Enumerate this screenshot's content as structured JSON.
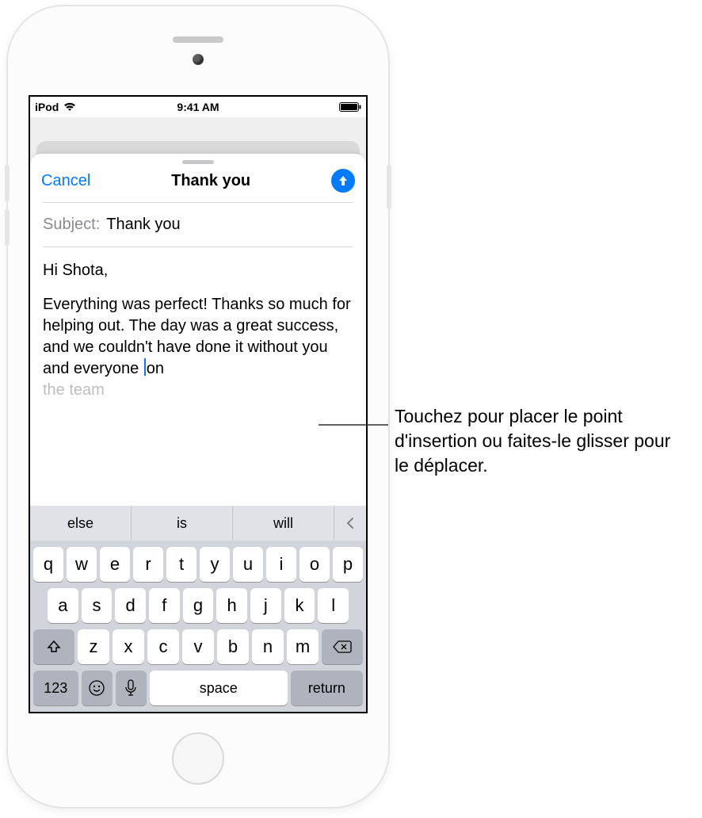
{
  "statusbar": {
    "carrier": "iPod",
    "time": "9:41 AM"
  },
  "compose": {
    "cancel": "Cancel",
    "title": "Thank you",
    "subject_label": "Subject:",
    "subject_value": "Thank you",
    "greeting": "Hi Shota,",
    "para_pre": "Everything was perfect! Thanks so much for helping out. The day was a great success, and we couldn't have done it without you and everyone ",
    "para_post_word": "on",
    "para_tail": "the team"
  },
  "predictive": {
    "s1": "else",
    "s2": "is",
    "s3": "will"
  },
  "keys": {
    "row1": [
      "q",
      "w",
      "e",
      "r",
      "t",
      "y",
      "u",
      "i",
      "o",
      "p"
    ],
    "row2": [
      "a",
      "s",
      "d",
      "f",
      "g",
      "h",
      "j",
      "k",
      "l"
    ],
    "row3": [
      "z",
      "x",
      "c",
      "v",
      "b",
      "n",
      "m"
    ],
    "numbers": "123",
    "space": "space",
    "return": "return"
  },
  "callout": {
    "text": "Touchez pour placer le point d'insertion ou faites-le glisser pour le déplacer."
  }
}
